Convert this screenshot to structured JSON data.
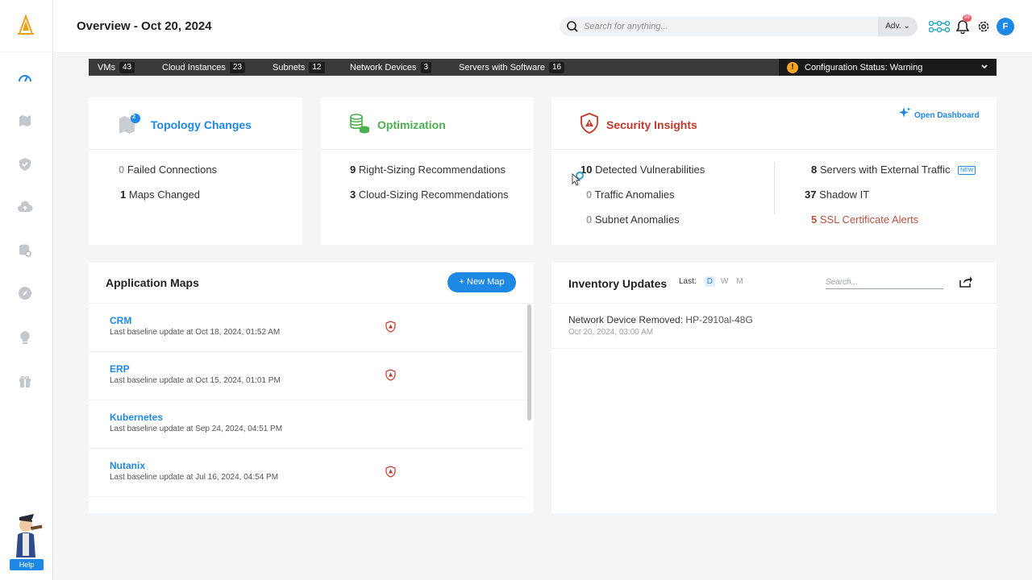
{
  "header": {
    "title": "Overview - Oct 20, 2024",
    "search_placeholder": "Search for anything...",
    "adv_label": "Adv.",
    "notif_count": "99",
    "avatar_initial": "F"
  },
  "counts": [
    {
      "label": "VMs",
      "value": "43"
    },
    {
      "label": "Cloud Instances",
      "value": "23"
    },
    {
      "label": "Subnets",
      "value": "12"
    },
    {
      "label": "Network Devices",
      "value": "3"
    },
    {
      "label": "Servers with Software",
      "value": "16"
    }
  ],
  "config_status": "Configuration Status: Warning",
  "topology": {
    "title": "Topology Changes",
    "badge": "2",
    "stats": [
      {
        "value": "0",
        "label": "Failed Connections"
      },
      {
        "value": "1",
        "label": "Maps Changed"
      }
    ]
  },
  "optimization": {
    "title": "Optimization",
    "stats": [
      {
        "value": "9",
        "label": "Right-Sizing Recommendations"
      },
      {
        "value": "3",
        "label": "Cloud-Sizing Recommendations"
      }
    ]
  },
  "security": {
    "title": "Security Insights",
    "open_dashboard": "Open Dashboard",
    "left": [
      {
        "value": "10",
        "label": "Detected Vulnerabilities"
      },
      {
        "value": "0",
        "label": "Traffic Anomalies"
      },
      {
        "value": "0",
        "label": "Subnet Anomalies"
      }
    ],
    "right": [
      {
        "value": "8",
        "label": "Servers with External Traffic",
        "badge": "NEW"
      },
      {
        "value": "37",
        "label": "Shadow IT"
      },
      {
        "value": "5",
        "label": "SSL Certificate Alerts"
      }
    ]
  },
  "app_maps": {
    "title": "Application Maps",
    "new_map_label": "New Map",
    "items": [
      {
        "name": "CRM",
        "sub": "Last baseline update at Oct 18, 2024, 01:52 AM"
      },
      {
        "name": "ERP",
        "sub": "Last baseline update at Oct 15, 2024, 01:01 PM"
      },
      {
        "name": "Kubernetes",
        "sub": "Last baseline update at Sep 24, 2024, 04:51 PM"
      },
      {
        "name": "Nutanix",
        "sub": "Last baseline update at Jul 16, 2024, 04:54 PM"
      }
    ]
  },
  "inventory": {
    "title": "Inventory Updates",
    "last_label": "Last:",
    "periods": [
      "D",
      "W",
      "M"
    ],
    "search_placeholder": "Search...",
    "items": [
      {
        "label": "Network Device Removed:",
        "value": "HP-2910al-48G",
        "time": "Oct 20, 2024, 03:00 AM"
      }
    ]
  },
  "help_label": "Help",
  "colors": {
    "accent": "#1e88e5",
    "security": "#c0392b",
    "optimization": "#4caf50",
    "warning": "#f5a623"
  }
}
